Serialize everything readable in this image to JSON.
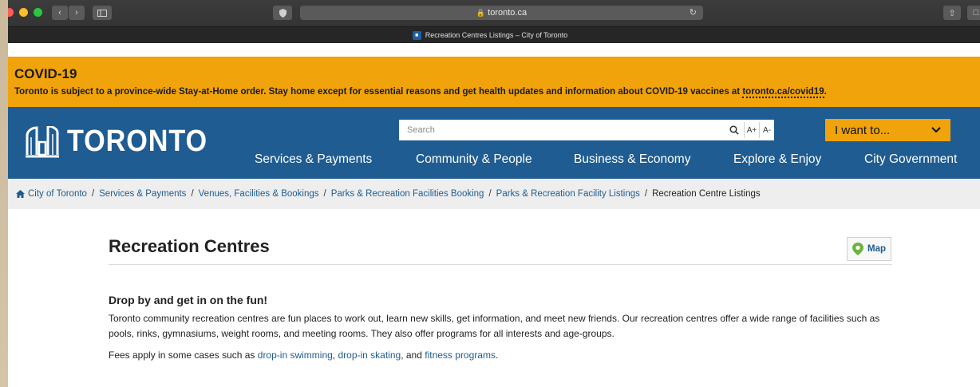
{
  "browser": {
    "url": "toronto.ca",
    "tab_title": "Recreation Centres Listings – City of Toronto"
  },
  "colors": {
    "accent_orange": "#f0a30b",
    "brand_blue": "#1e5c92",
    "link_blue": "#1e5c92"
  },
  "covid": {
    "title": "COVID-19",
    "message": "Toronto is subject to a province-wide Stay-at-Home order. Stay home except for essential reasons and get health updates and information about COVID-19 vaccines at",
    "link_text": "toronto.ca/covid19",
    "end": "."
  },
  "header": {
    "logo_text": "TORONTO",
    "search_placeholder": "Search",
    "font_increase": "A+",
    "font_decrease": "A-",
    "i_want_to": "I want to...",
    "nav": [
      {
        "label": "Services & Payments"
      },
      {
        "label": "Community & People"
      },
      {
        "label": "Business & Economy"
      },
      {
        "label": "Explore & Enjoy"
      },
      {
        "label": "City Government"
      }
    ]
  },
  "breadcrumb": {
    "items": [
      "City of Toronto",
      "Services & Payments",
      "Venues, Facilities & Bookings",
      "Parks & Recreation Facilities Booking",
      "Parks & Recreation Facility Listings"
    ],
    "current": "Recreation Centre Listings"
  },
  "main": {
    "title": "Recreation Centres",
    "map_button": "Map",
    "subheading": "Drop by and get in on the fun!",
    "paragraph1": "Toronto community recreation centres are fun places to work out, learn new skills, get information, and meet new friends. Our recreation centres offer a wide range of facilities such as pools, rinks, gymnasiums, weight rooms, and meeting rooms. They also offer programs for all interests and age-groups.",
    "fees_prefix": "Fees apply in some cases such as",
    "fees_link1": "drop-in swimming",
    "fees_sep1": ",",
    "fees_link2": "drop-in skating",
    "fees_sep2": ", and",
    "fees_link3": "fitness programs",
    "fees_end": "."
  }
}
